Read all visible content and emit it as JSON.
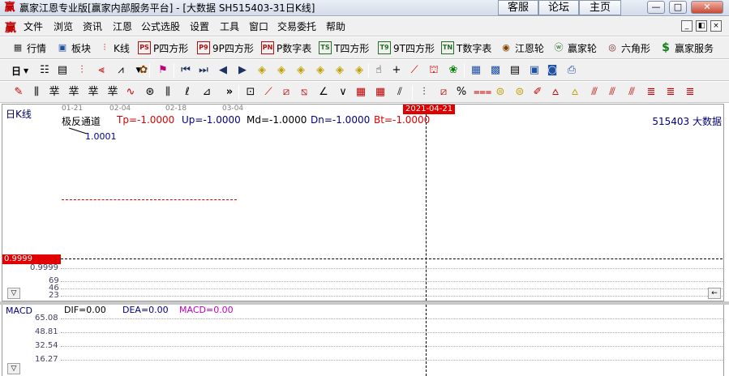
{
  "window": {
    "icon": "赢",
    "title": "赢家江恩专业版[赢家内部服务平台] - [大数据  SH515403-31日K线]",
    "buttons": [
      "客服",
      "论坛",
      "主页"
    ],
    "controls": [
      "—",
      "□",
      "✕"
    ]
  },
  "menubar": {
    "logo": "赢",
    "items": [
      "文件",
      "浏览",
      "资讯",
      "江恩",
      "公式选股",
      "设置",
      "工具",
      "窗口",
      "交易委托",
      "帮助"
    ],
    "mdi_controls": [
      "_",
      "◧",
      "×"
    ]
  },
  "toolbar1": {
    "items": [
      {
        "label": "行情",
        "icon": "grid-icon"
      },
      {
        "label": "板块",
        "icon": "blocks-icon"
      },
      {
        "label": "K线",
        "icon": "kline-icon"
      },
      {
        "label": "P四方形",
        "icon": "PS"
      },
      {
        "label": "9P四方形",
        "icon": "P9"
      },
      {
        "label": "P数字表",
        "icon": "PN"
      },
      {
        "label": "T四方形",
        "icon": "TS"
      },
      {
        "label": "9T四方形",
        "icon": "T9"
      },
      {
        "label": "T数字表",
        "icon": "TN"
      },
      {
        "label": "江恩轮",
        "icon": "wheel-icon"
      },
      {
        "label": "赢家轮",
        "icon": "win-wheel-icon"
      },
      {
        "label": "六角形",
        "icon": "hexagon-icon"
      },
      {
        "label": "赢家服务",
        "icon": "dollar-icon"
      }
    ]
  },
  "toolbar2": {
    "period": "日"
  },
  "chart": {
    "period_label": "日K线",
    "x_ticks": [
      "01-21",
      "02-04",
      "02-18",
      "03-04"
    ],
    "marker_date": "2021-04-21",
    "indicator": {
      "name": "极反通道",
      "tp": "Tp=-1.0000",
      "up": "Up=-1.0000",
      "md": "Md=-1.0000",
      "dn": "Dn=-1.0000",
      "bt": "Bt=-1.0000"
    },
    "code_name": "515403 大数据",
    "annotation": "1.0001",
    "price_tag": "0.9999",
    "y_labels": [
      "0.9999",
      "69",
      "46",
      "23"
    ],
    "colors": {
      "marker": "#e00000",
      "tp": "#e00000",
      "up": "#000080",
      "md": "#000000",
      "dn": "#000080",
      "bt": "#e00000"
    }
  },
  "macd": {
    "name": "MACD",
    "dif": "DIF=0.00",
    "dea": "DEA=0.00",
    "macd": "MACD=0.00",
    "y_labels": [
      "65.08",
      "48.81",
      "32.54",
      "16.27"
    ],
    "colors": {
      "dif": "#000000",
      "dea": "#000080",
      "macd": "#c000c0"
    }
  }
}
